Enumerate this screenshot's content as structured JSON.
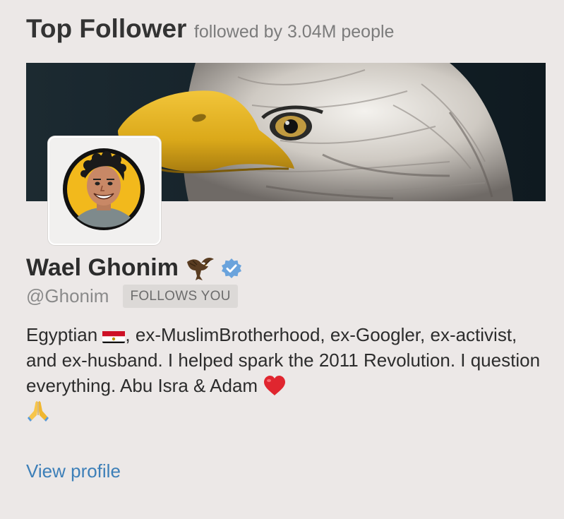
{
  "header": {
    "title": "Top Follower",
    "subtitle": "followed by 3.04M people"
  },
  "banner": {
    "image": "bald-eagle-close-up",
    "colors": {
      "background": "#16232a",
      "beak": "#e6b51c",
      "feathers": "#d8d4cf"
    }
  },
  "profile": {
    "avatar": "cartoon-portrait-avatar",
    "name": "Wael Ghonim",
    "name_emoji": "eagle-emoji",
    "verified_icon": "verified-badge-icon",
    "handle": "@Ghonim",
    "follows_badge": "FOLLOWS YOU",
    "bio": {
      "part1": "Egyptian ",
      "flag": "egypt-flag-emoji",
      "part2": ", ex-MuslimBrotherhood, ex-Googler, ex-activist, and ex-husband. I helped spark the 2011 Revolution. I question everything. Abu Isra & Adam ",
      "heart": "red-heart-emoji",
      "hands": "folded-hands-emoji"
    }
  },
  "actions": {
    "view_profile": "View profile"
  },
  "colors": {
    "background": "#ece8e7",
    "link": "#3d7fb8",
    "verified": "#6aa3dc"
  }
}
